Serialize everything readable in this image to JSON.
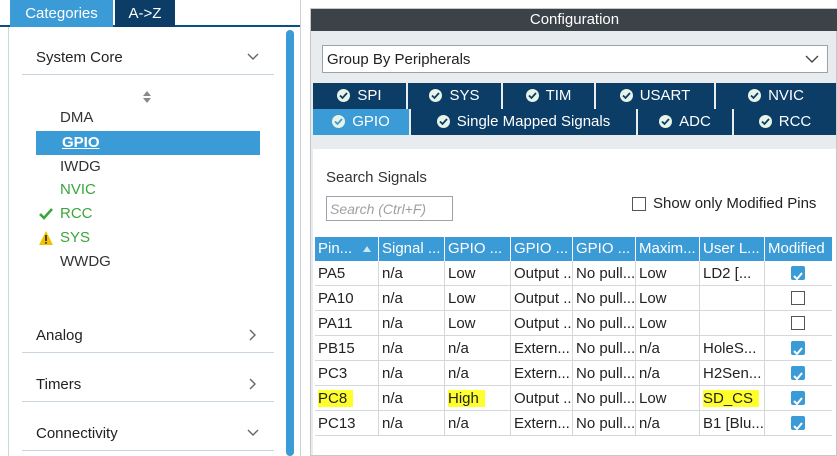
{
  "left": {
    "tabs": [
      "Categories",
      "A->Z"
    ],
    "sections": {
      "system_core": "System Core",
      "analog": "Analog",
      "timers": "Timers",
      "connectivity": "Connectivity"
    },
    "items": [
      {
        "label": "DMA",
        "status": "none",
        "color": "gray"
      },
      {
        "label": "GPIO",
        "status": "selected",
        "color": "white"
      },
      {
        "label": "IWDG",
        "status": "none",
        "color": "gray"
      },
      {
        "label": "NVIC",
        "status": "none",
        "color": "green"
      },
      {
        "label": "RCC",
        "status": "ok",
        "color": "green"
      },
      {
        "label": "SYS",
        "status": "warning",
        "color": "green"
      },
      {
        "label": "WWDG",
        "status": "none",
        "color": "gray"
      }
    ]
  },
  "config": {
    "title": "Configuration",
    "group_by": "Group By Peripherals",
    "tabs_row1": [
      "SPI",
      "SYS",
      "TIM",
      "USART",
      "NVIC"
    ],
    "tabs_row2": [
      "GPIO",
      "Single Mapped Signals",
      "ADC",
      "RCC"
    ],
    "active_tab": "GPIO",
    "search_label": "Search Signals",
    "search_placeholder": "Search (Ctrl+F)",
    "show_modified_label": "Show only Modified Pins",
    "columns": [
      "Pin...",
      "Signal ...",
      "GPIO ...",
      "GPIO ...",
      "GPIO ...",
      "Maxim...",
      "User L...",
      "Modified"
    ],
    "rows": [
      {
        "pin": "PA5",
        "signal": "n/a",
        "level": "Low",
        "mode": "Output ...",
        "pull": "No pull...",
        "speed": "Low",
        "label": "LD2 [...",
        "modified": true,
        "highlight": false
      },
      {
        "pin": "PA10",
        "signal": "n/a",
        "level": "Low",
        "mode": "Output ...",
        "pull": "No pull...",
        "speed": "Low",
        "label": "",
        "modified": false,
        "highlight": false
      },
      {
        "pin": "PA11",
        "signal": "n/a",
        "level": "Low",
        "mode": "Output ...",
        "pull": "No pull...",
        "speed": "Low",
        "label": "",
        "modified": false,
        "highlight": false
      },
      {
        "pin": "PB15",
        "signal": "n/a",
        "level": "n/a",
        "mode": "Extern...",
        "pull": "No pull...",
        "speed": "n/a",
        "label": "HoleS...",
        "modified": true,
        "highlight": false
      },
      {
        "pin": "PC3",
        "signal": "n/a",
        "level": "n/a",
        "mode": "Extern...",
        "pull": "No pull...",
        "speed": "n/a",
        "label": "H2Sen...",
        "modified": true,
        "highlight": false
      },
      {
        "pin": "PC8",
        "signal": "n/a",
        "level": "High",
        "mode": "Output ...",
        "pull": "No pull...",
        "speed": "Low",
        "label": "SD_CS",
        "modified": true,
        "highlight": true
      },
      {
        "pin": "PC13",
        "signal": "n/a",
        "level": "n/a",
        "mode": "Extern...",
        "pull": "No pull...",
        "speed": "n/a",
        "label": "B1 [Blu...",
        "modified": true,
        "highlight": false
      }
    ]
  },
  "colors": {
    "accent": "#3a9bd6",
    "dark_tab": "#0b3d66",
    "title_bar": "#3b4248",
    "ok_green": "#3aa53a",
    "highlight": "#ffff2e"
  }
}
